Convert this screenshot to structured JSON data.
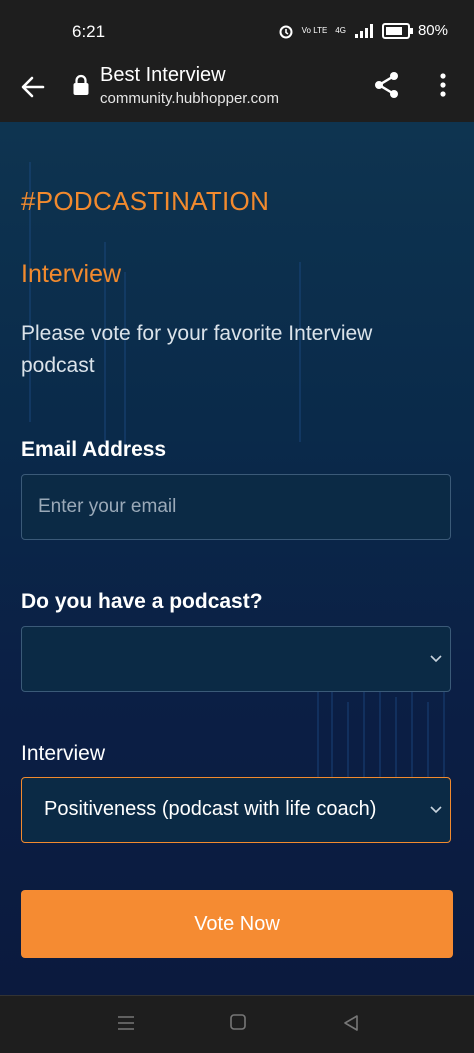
{
  "status": {
    "time": "6:21",
    "network_small": "Vo LTE",
    "network_type": "4G",
    "battery": "80%"
  },
  "browser": {
    "title": "Best Interview",
    "url": "community.hubhopper.com"
  },
  "page": {
    "hashtag": "#PODCASTINATION",
    "section_title": "Interview",
    "description": "Please vote for your favorite Interview podcast",
    "email": {
      "label": "Email Address",
      "placeholder": "Enter your email",
      "value": ""
    },
    "podcast": {
      "label": "Do you have a podcast?",
      "selected": ""
    },
    "interview": {
      "label": "Interview",
      "selected": "Positiveness (podcast with life coach)"
    },
    "vote_button": "Vote Now"
  },
  "colors": {
    "accent": "#f28a2e",
    "button": "#f58b32",
    "bg_top": "#0e3450",
    "bg_bottom": "#0b1a3e"
  },
  "icons": {
    "back": "arrow-left-icon",
    "lock": "lock-icon",
    "share": "share-icon",
    "more": "more-vertical-icon"
  }
}
